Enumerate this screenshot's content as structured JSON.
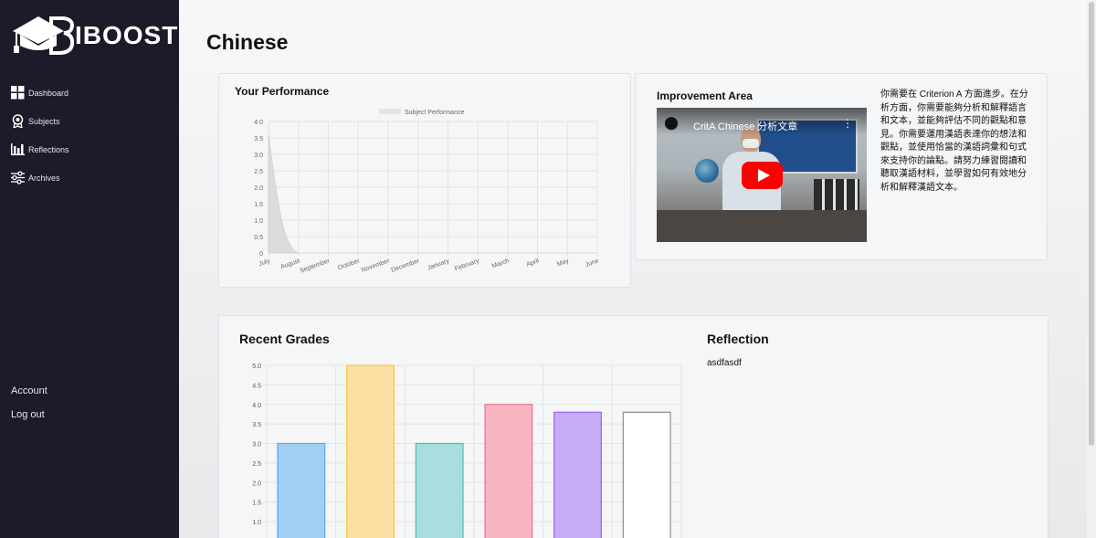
{
  "sidebar": {
    "logo_text": "IBOOST",
    "items": [
      {
        "label": "Dashboard",
        "icon": "grid-icon"
      },
      {
        "label": "Subjects",
        "icon": "badge-icon"
      },
      {
        "label": "Reflections",
        "icon": "bar-chart-icon"
      },
      {
        "label": "Archives",
        "icon": "sliders-icon"
      }
    ],
    "account": "Account",
    "logout": "Log out"
  },
  "page": {
    "title": "Chinese"
  },
  "performance": {
    "title": "Your Performance",
    "chart_data": {
      "type": "area",
      "legend": [
        "Subject Performance"
      ],
      "legend_position": "top",
      "categories": [
        "July",
        "August",
        "September",
        "October",
        "November",
        "December",
        "January",
        "February",
        "March",
        "April",
        "May",
        "June"
      ],
      "y_ticks": [
        "4.0",
        "3.5",
        "3.0",
        "2.5",
        "2.0",
        "1.5",
        "1.0",
        "0.5",
        "0"
      ],
      "ylim": [
        0,
        4
      ],
      "series": [
        {
          "name": "Subject Performance",
          "values": [
            3.6,
            0,
            0,
            0,
            0,
            0,
            0,
            0,
            0,
            0,
            0,
            0
          ],
          "color": "#dcdcdc"
        }
      ],
      "grid": true
    }
  },
  "improvement": {
    "title": "Improvement Area",
    "video_title": "CritA Chinese 分析文章",
    "text": "你需要在 Criterion A 方面進步。在分析方面，你需要能夠分析和解釋語言和文本，並能夠評估不同的觀點和意見。你需要運用漢語表達你的想法和觀點，並使用恰當的漢語詞彙和句式來支持你的論點。請努力練習閱讀和聽取漢語材料，並學習如何有效地分析和解釋漢語文本。"
  },
  "grades": {
    "title": "Recent Grades",
    "chart_data": {
      "type": "bar",
      "y_ticks": [
        "5.0",
        "4.5",
        "4.0",
        "3.5",
        "3.0",
        "2.5",
        "2.0",
        "1.5",
        "1.0"
      ],
      "ylim": [
        1,
        5
      ],
      "values": [
        3.0,
        5.0,
        3.0,
        4.0,
        3.8,
        3.8
      ],
      "colors": [
        {
          "fill": "#9fcff3",
          "stroke": "#5fa8e3"
        },
        {
          "fill": "#fbe0a3",
          "stroke": "#f5c54e"
        },
        {
          "fill": "#a8dedd",
          "stroke": "#4bbfb8"
        },
        {
          "fill": "#f9b4c2",
          "stroke": "#f0738e"
        },
        {
          "fill": "#c6abf6",
          "stroke": "#9a66ee"
        },
        {
          "fill": "#ffffff",
          "stroke": "#8e8e8e"
        }
      ],
      "grid": true
    }
  },
  "reflection": {
    "title": "Reflection",
    "text": "asdfasdf"
  }
}
